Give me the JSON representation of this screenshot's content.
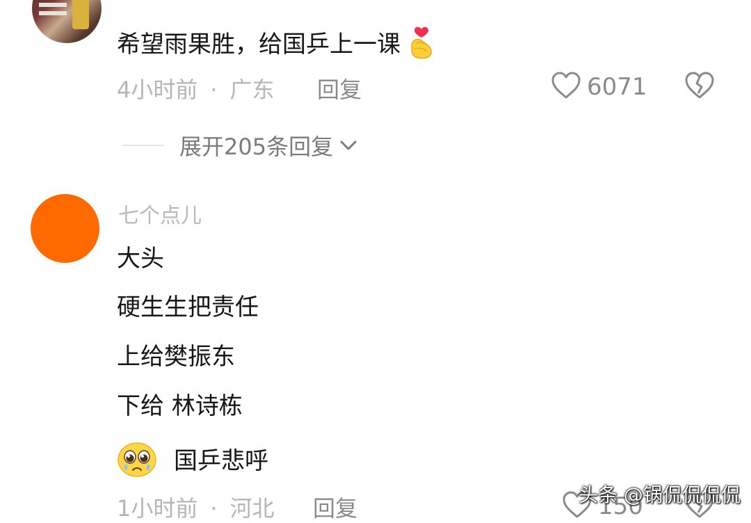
{
  "comments": [
    {
      "content_lines": [
        "希望雨果胜，给国乒上一课"
      ],
      "time": "4小时前",
      "separator": "·",
      "location": "广东",
      "reply_label": "回复",
      "like_count": "6071",
      "expand_label": "展开205条回复"
    },
    {
      "username": "七个点儿",
      "content_lines": [
        "大头",
        " 硬生生把责任",
        "上给樊振东",
        "下给 林诗栋",
        "国乒悲呼"
      ],
      "time": "1小时前",
      "separator": "·",
      "location": "河北",
      "reply_label": "回复",
      "like_count": "150"
    }
  ],
  "watermark": "头条 @锅侃侃侃侃",
  "colors": {
    "avatar_orange": "#ff6a00",
    "text_primary": "#161616",
    "text_muted": "#b5b5b5",
    "text_action": "#8a8a8a"
  },
  "icons": [
    "heart-outline-icon",
    "broken-heart-icon",
    "chevron-down-icon",
    "finger-heart-emoji",
    "pleading-face-emoji"
  ]
}
